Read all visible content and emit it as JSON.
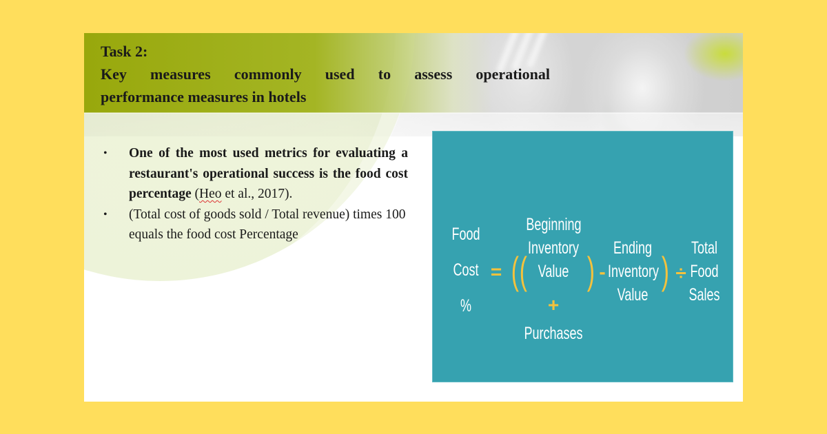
{
  "slide": {
    "title_line1": "Task 2:",
    "title_line2": "Key measures commonly used to assess operational",
    "title_line3": "performance measures in hotels",
    "bullets": [
      {
        "bold_text": "One of the most used metrics for evaluating a restaurant's operational success is the food cost percentage",
        "citation_open": " (",
        "citation_author": "Heo",
        "citation_rest": " et al., 2017)."
      },
      {
        "text": "(Total cost of goods sold / Total revenue) times 100 equals the food cost Percentage"
      }
    ],
    "bullet_glyph": "•"
  },
  "formula": {
    "lhs": [
      "Food",
      "Cost",
      "%"
    ],
    "equals": "=",
    "open_outer": "(",
    "open_inner": "(",
    "beginning": [
      "Beginning",
      "Inventory",
      "Value"
    ],
    "plus": "+",
    "purchases": "Purchases",
    "close_inner": ")",
    "minus": "-",
    "ending": [
      "Ending",
      "Inventory",
      "Value"
    ],
    "close_outer": ")",
    "divide": "÷",
    "sales": [
      "Total",
      "Food",
      "Sales"
    ],
    "colors": {
      "box": "#36a2b0",
      "operator": "#f5c23c",
      "text": "#ffffff"
    }
  },
  "colors": {
    "page_background": "#ffde5c",
    "header_green": "#98a80c"
  }
}
